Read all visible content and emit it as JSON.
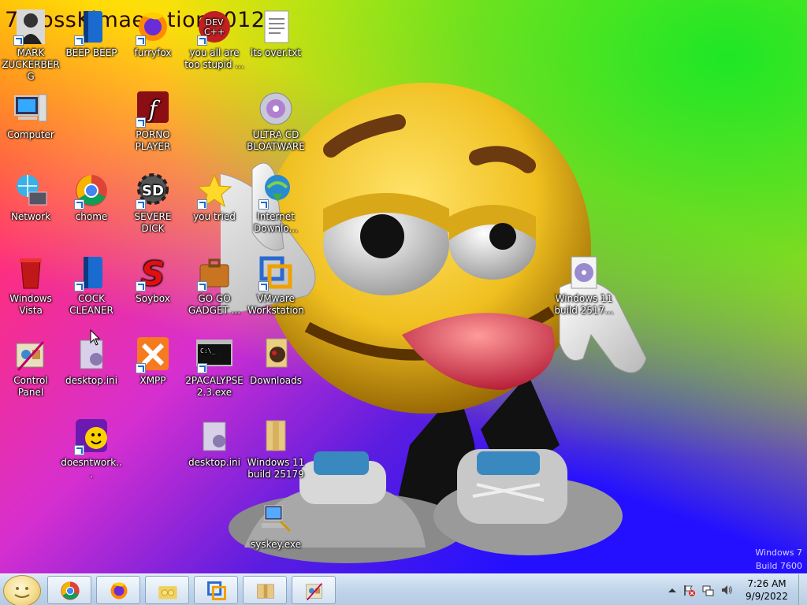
{
  "desktop": {
    "wallpaper_text": "7…ossKimae…tion2012",
    "watermark_line1": "Windows 7",
    "watermark_line2": "Build 7600",
    "icons": [
      {
        "label": "MARK ZUCKERBERG",
        "icon": "person-photo-icon"
      },
      {
        "label": "BEEP BEEP",
        "icon": "blue-book-icon"
      },
      {
        "label": "furryfox",
        "icon": "firefox-icon"
      },
      {
        "label": "you all are too stupid ...",
        "icon": "devcpp-icon"
      },
      {
        "label": "its over.txt",
        "icon": "text-file-icon"
      },
      {
        "label": "Computer",
        "icon": "computer-icon"
      },
      {
        "label": "PORNO PLAYER",
        "icon": "flash-player-icon"
      },
      {
        "label": "ULTRA CD BLOATWARE",
        "icon": "cd-disc-icon"
      },
      {
        "label": "Network",
        "icon": "network-globe-icon"
      },
      {
        "label": "chome",
        "icon": "chrome-icon"
      },
      {
        "label": "SEVERE DICK",
        "icon": "sd-gear-icon"
      },
      {
        "label": "you tried",
        "icon": "star-icon"
      },
      {
        "label": "Internet Downlo...",
        "icon": "internet-download-icon"
      },
      {
        "label": "Windows Vista",
        "icon": "recycle-bin-icon"
      },
      {
        "label": "COCK CLEANER",
        "icon": "blue-book-icon"
      },
      {
        "label": "Soybox",
        "icon": "soybox-icon"
      },
      {
        "label": "GO GO GADGET ...",
        "icon": "briefcase-icon"
      },
      {
        "label": "VMware Workstation",
        "icon": "vmware-icon"
      },
      {
        "label": "Windows 11 build 2517...",
        "icon": "disc-image-icon"
      },
      {
        "label": "Control Panel",
        "icon": "control-panel-icon"
      },
      {
        "label": "desktop.ini",
        "icon": "ini-file-icon"
      },
      {
        "label": "XMPP",
        "icon": "xampp-icon"
      },
      {
        "label": "2PACALYPSE 2.3.exe",
        "icon": "cmd-exe-icon"
      },
      {
        "label": "Downloads",
        "icon": "downloads-folder-icon"
      },
      {
        "label": "doesntwork...",
        "icon": "yahoo-messenger-icon"
      },
      {
        "label": "desktop.ini",
        "icon": "ini-file-icon"
      },
      {
        "label": "Windows 11 build 25179",
        "icon": "folder-icon"
      },
      {
        "label": "syskey.exe",
        "icon": "syskey-icon"
      }
    ]
  },
  "taskbar": {
    "start_icon": "smiley-start-orb-icon",
    "pinned": [
      {
        "icon": "chrome-icon"
      },
      {
        "icon": "firefox-icon"
      },
      {
        "icon": "users-folder-icon"
      },
      {
        "icon": "vmware-icon"
      },
      {
        "icon": "archive-folder-icon"
      },
      {
        "icon": "control-panel-icon"
      }
    ],
    "clock_time": "7:26 AM",
    "clock_date": "9/9/2022"
  },
  "colors": {
    "taskbar_bg": "#c1d5ea",
    "icon_text": "#ffffff",
    "smiley_yellow": "#f0c020"
  }
}
